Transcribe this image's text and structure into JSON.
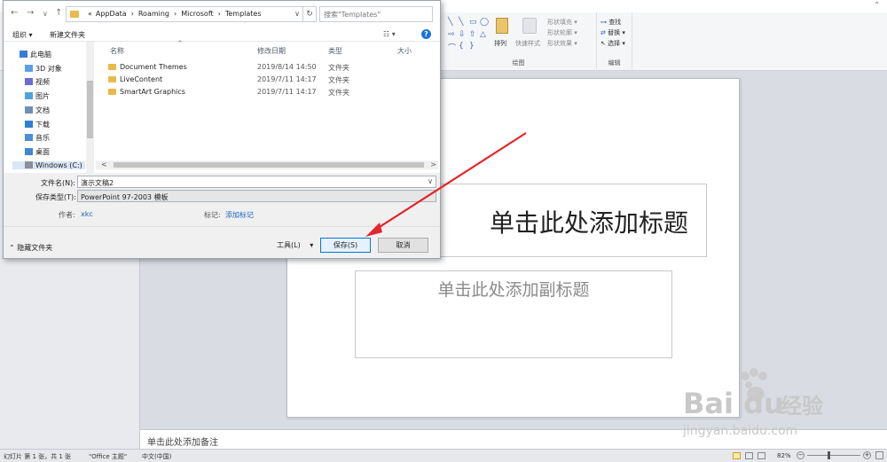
{
  "dialog": {
    "nav": {
      "back": "←",
      "forward": "→",
      "dropdown": "∨",
      "up": "↑"
    },
    "breadcrumb": [
      "«",
      "AppData",
      "Roaming",
      "Microsoft",
      "Templates"
    ],
    "breadcrumb_sep": "›",
    "refresh": "↻",
    "search_placeholder": "搜索\"Templates\"",
    "toolbar": {
      "organize": "组织 ▾",
      "new_folder": "新建文件夹",
      "view": "☷ ▾",
      "help": "?"
    },
    "nav_pane": [
      {
        "label": "此电脑",
        "color": "#3a7bd5"
      },
      {
        "label": "3D 对象",
        "color": "#5aa0e6"
      },
      {
        "label": "视频",
        "color": "#6b6bd6"
      },
      {
        "label": "图片",
        "color": "#4fa3d9"
      },
      {
        "label": "文档",
        "color": "#6f8fb4"
      },
      {
        "label": "下载",
        "color": "#2f7fd0"
      },
      {
        "label": "音乐",
        "color": "#4a90d9"
      },
      {
        "label": "桌面",
        "color": "#3f86d6"
      },
      {
        "label": "Windows (C:)",
        "color": "#8a8f99"
      }
    ],
    "columns": [
      "名称",
      "修改日期",
      "类型",
      "大小"
    ],
    "files": [
      {
        "name": "Document Themes",
        "date": "2019/8/14 14:50",
        "type": "文件夹"
      },
      {
        "name": "LiveContent",
        "date": "2019/7/11 14:17",
        "type": "文件夹"
      },
      {
        "name": "SmartArt Graphics",
        "date": "2019/7/11 14:17",
        "type": "文件夹"
      }
    ],
    "scroll": {
      "left": "<",
      "right": ">"
    },
    "filename_label": "文件名(N):",
    "filename_value": "演示文稿2",
    "filetype_label": "保存类型(T):",
    "filetype_value": "PowerPoint 97-2003 模板",
    "author_label": "作者:",
    "author_value": "xkc",
    "tags_label": "标记:",
    "tags_value": "添加标记",
    "hide_folders": "隐藏文件夹",
    "tools_label": "工具(L)",
    "save_label": "保存(S)",
    "cancel_label": "取消"
  },
  "ribbon": {
    "drawing_group": "绘图",
    "editing_group": "编辑",
    "arrange": "排列",
    "quick_styles": "快速样式",
    "shape_fill": "形状填充 ▾",
    "shape_outline": "形状轮廓 ▾",
    "shape_effects": "形状效果 ▾",
    "find": "查找",
    "replace": "替换 ▾",
    "select": "选择 ▾"
  },
  "slide": {
    "title_placeholder": "单击此处添加标题",
    "subtitle_placeholder": "单击此处添加副标题"
  },
  "notes_placeholder": "单击此处添加备注",
  "statusbar": {
    "slide_info": "幻灯片 第 1 张，共 1 张",
    "theme": "\"Office 主题\"",
    "language": "中文(中国)",
    "zoom": "82%"
  },
  "watermark": {
    "brand": "Bai du 经验",
    "url": "jingyan.baidu.com"
  },
  "colors": {
    "accent": "#0078d7",
    "arrow": "#e3262b",
    "folder": "#e9b94a",
    "link": "#1a65c0"
  }
}
